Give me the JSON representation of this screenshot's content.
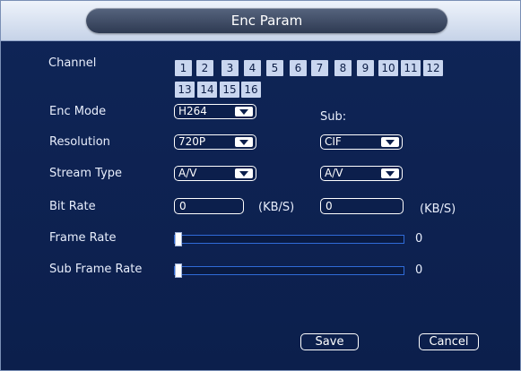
{
  "window": {
    "title": "Enc Param"
  },
  "labels": {
    "channel": "Channel",
    "enc_mode": "Enc Mode",
    "sub": "Sub:",
    "resolution": "Resolution",
    "stream_type": "Stream Type",
    "bit_rate": "Bit Rate",
    "frame_rate": "Frame Rate",
    "sub_frame_rate": "Sub Frame Rate"
  },
  "channels": [
    "1",
    "2",
    "3",
    "4",
    "5",
    "6",
    "7",
    "8",
    "9",
    "10",
    "11",
    "12",
    "13",
    "14",
    "15",
    "16"
  ],
  "main": {
    "enc_mode": "H264",
    "resolution": "720P",
    "stream_type": "A/V",
    "bit_rate": "0",
    "bit_rate_unit": "(KB/S)"
  },
  "sub": {
    "resolution": "CIF",
    "stream_type": "A/V",
    "bit_rate": "0",
    "bit_rate_unit": "(KB/S)"
  },
  "frame_rate": {
    "value": "0",
    "level": 0
  },
  "sub_frame_rate": {
    "value": "0",
    "level": 0
  },
  "buttons": {
    "save": "Save",
    "cancel": "Cancel"
  },
  "colors": {
    "panel": "#0c1f4c",
    "channel_button": "#c9d6ef",
    "slider_border": "#2f6bd8",
    "title_pill": "#3d4a63"
  }
}
